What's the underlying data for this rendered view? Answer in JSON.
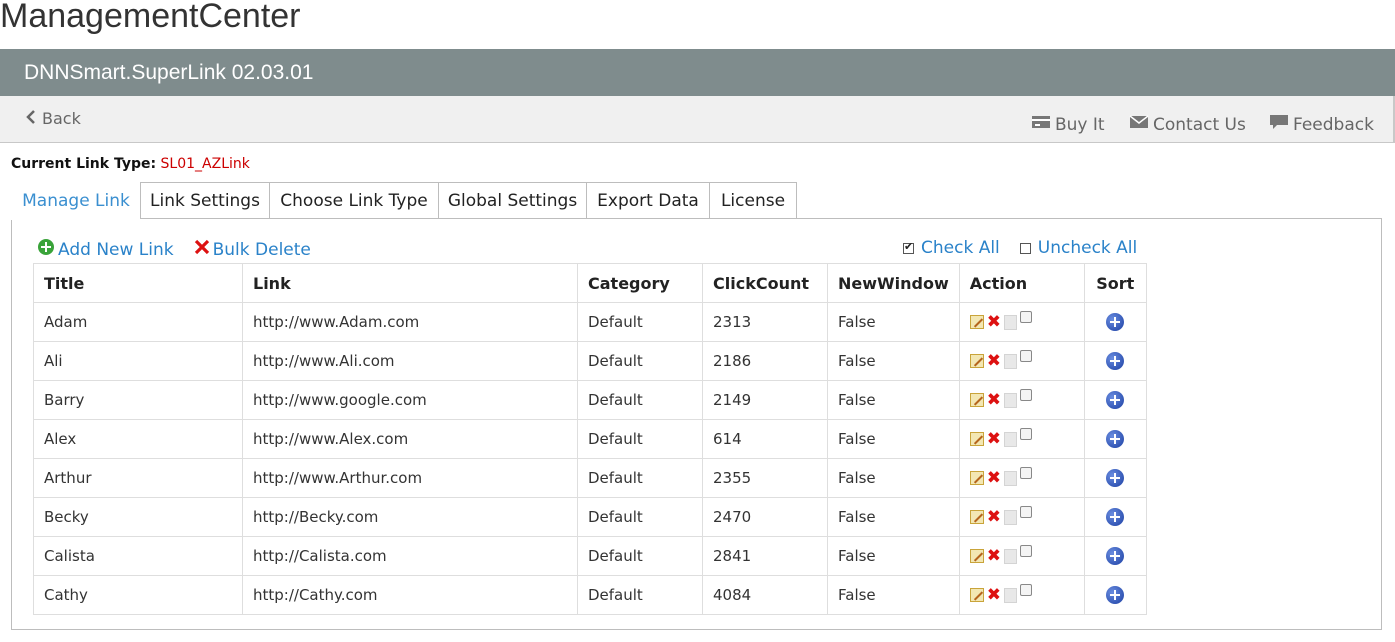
{
  "app": {
    "title": "ManagementCenter"
  },
  "module": {
    "title": "DNNSmart.SuperLink 02.03.01"
  },
  "toolbar": {
    "back_label": "Back",
    "buy_label": "Buy It",
    "contact_label": "Contact Us",
    "feedback_label": "Feedback"
  },
  "link_type": {
    "label": "Current Link Type:",
    "value": "SL01_AZLink"
  },
  "tabs": [
    {
      "label": "Manage Link",
      "active": true
    },
    {
      "label": "Link Settings"
    },
    {
      "label": "Choose Link Type"
    },
    {
      "label": "Global Settings"
    },
    {
      "label": "Export Data"
    },
    {
      "label": "License"
    }
  ],
  "actions": {
    "add_label": "Add New Link",
    "bulk_delete_label": "Bulk Delete",
    "check_all_label": "Check All",
    "uncheck_all_label": "Uncheck All"
  },
  "table": {
    "headers": [
      "Title",
      "Link",
      "Category",
      "ClickCount",
      "NewWindow",
      "Action",
      "Sort"
    ],
    "rows": [
      {
        "title": "Adam",
        "link": "http://www.Adam.com",
        "category": "Default",
        "clicks": "2313",
        "new_window": "False"
      },
      {
        "title": "Ali",
        "link": "http://www.Ali.com",
        "category": "Default",
        "clicks": "2186",
        "new_window": "False"
      },
      {
        "title": "Barry",
        "link": "http://www.google.com",
        "category": "Default",
        "clicks": "2149",
        "new_window": "False"
      },
      {
        "title": "Alex",
        "link": "http://www.Alex.com",
        "category": "Default",
        "clicks": "614",
        "new_window": "False"
      },
      {
        "title": "Arthur",
        "link": "http://www.Arthur.com",
        "category": "Default",
        "clicks": "2355",
        "new_window": "False"
      },
      {
        "title": "Becky",
        "link": "http://Becky.com",
        "category": "Default",
        "clicks": "2470",
        "new_window": "False"
      },
      {
        "title": "Calista",
        "link": "http://Calista.com",
        "category": "Default",
        "clicks": "2841",
        "new_window": "False"
      },
      {
        "title": "Cathy",
        "link": "http://Cathy.com",
        "category": "Default",
        "clicks": "4084",
        "new_window": "False"
      }
    ]
  },
  "colors": {
    "header_bar": "#7f8c8d",
    "link": "#2a82c9",
    "link_type_value": "#cc0000"
  }
}
